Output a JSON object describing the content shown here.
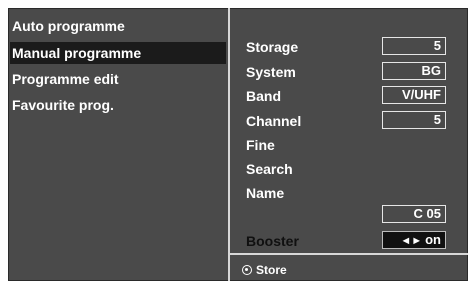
{
  "left_menu": {
    "items": [
      {
        "label": "Auto programme",
        "selected": false
      },
      {
        "label": "Manual programme",
        "selected": true
      },
      {
        "label": "Programme edit",
        "selected": false
      },
      {
        "label": "Favourite prog.",
        "selected": false
      }
    ]
  },
  "fields": {
    "storage": {
      "label": "Storage",
      "value": "5"
    },
    "system": {
      "label": "System",
      "value": "BG"
    },
    "band": {
      "label": "Band",
      "value": "V/UHF"
    },
    "channel": {
      "label": "Channel",
      "value": "5"
    },
    "fine": {
      "label": "Fine"
    },
    "search": {
      "label": "Search"
    },
    "name": {
      "label": "Name",
      "value": "C 05"
    },
    "booster": {
      "label": "Booster",
      "value": "on",
      "arrows": "◄►"
    }
  },
  "footer": {
    "store_label": "Store"
  },
  "colors": {
    "panel": "#4a4a4a",
    "selected_row": "#1b1b1b",
    "text": "#ffffff",
    "divider": "#d8d8d8"
  }
}
